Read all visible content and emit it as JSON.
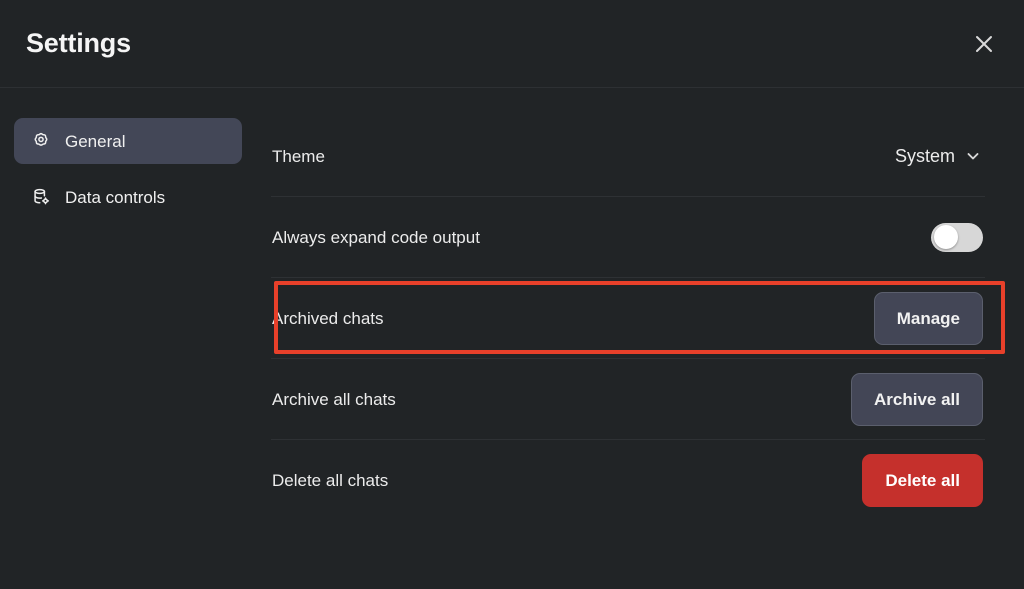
{
  "dialog": {
    "title": "Settings",
    "close_icon": "close-icon",
    "close_label": "Close"
  },
  "sidebar": {
    "items": [
      {
        "label": "General",
        "icon": "gear-icon",
        "active": true
      },
      {
        "label": "Data controls",
        "icon": "database-gear-icon",
        "active": false
      }
    ]
  },
  "settings": {
    "rows": [
      {
        "label": "Theme",
        "control": "select",
        "value": "System",
        "chevron_icon": "chevron-down-icon"
      },
      {
        "label": "Always expand code output",
        "control": "toggle",
        "value": "off"
      },
      {
        "label": "Archived chats",
        "control": "button",
        "button_label": "Manage",
        "button_style": "slate",
        "highlighted": true
      },
      {
        "label": "Archive all chats",
        "control": "button",
        "button_label": "Archive all",
        "button_style": "slate",
        "highlighted": false
      },
      {
        "label": "Delete all chats",
        "control": "button",
        "button_label": "Delete all",
        "button_style": "danger",
        "highlighted": false
      }
    ]
  },
  "colors": {
    "background": "#212426",
    "sidebar_active": "#434757",
    "button_slate": "#434656",
    "button_danger": "#c5302c",
    "annotation_red": "#e8402a",
    "divider": "#2e3134",
    "text_primary": "#ececec",
    "toggle_track": "#d7d7d7",
    "toggle_knob": "#ffffff"
  },
  "annotation": {
    "target": "Archived chats",
    "shape": "rectangle-outline"
  }
}
